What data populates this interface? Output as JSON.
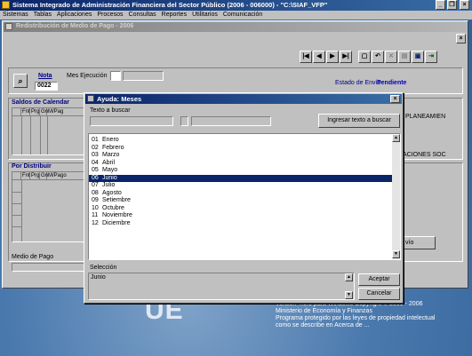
{
  "app": {
    "title": "Sistema Integrado de Administración Financiera del Sector Público (2006 - 006000) - \"C:\\SIAF_VFP\"",
    "menu": [
      "Sistemas",
      "Tablas",
      "Aplicaciones",
      "Procesos",
      "Consultas",
      "Reportes",
      "Utilitarios",
      "Comunicación"
    ]
  },
  "main_window": {
    "title": "Redistribución de Medio de Pago - 2006",
    "nota_label": "Nota",
    "nota_value": "0022",
    "mes_ejecucion_label": "Mes Ejecución",
    "estado_envio_label": "Estado de Envío",
    "estado_envio_value": "Pendiente",
    "saldos_label": "Saldos de Calendar",
    "saldos_columns": [
      "Fnt",
      "Prg",
      "Gn",
      "M/Pag"
    ],
    "por_distribuir_label": "Por Distribuir",
    "por_distribuir_columns": [
      "Fnt",
      "Prg",
      "Gn",
      "M/Pago"
    ],
    "medio_pago_label": "Medio de Pago",
    "right_text_1": "PLANEAMIEN",
    "right_text_2": "ACIONES SOC",
    "right_button": "vío"
  },
  "dialog": {
    "title": "Ayuda: Meses",
    "search_label": "Texto a buscar",
    "search_button": "Ingresar texto a buscar",
    "items": [
      {
        "code": "01",
        "name": "Enero"
      },
      {
        "code": "02",
        "name": "Febrero"
      },
      {
        "code": "03",
        "name": "Marzo"
      },
      {
        "code": "04",
        "name": "Abril"
      },
      {
        "code": "05",
        "name": "Mayo"
      },
      {
        "code": "06",
        "name": "Junio"
      },
      {
        "code": "07",
        "name": "Julio"
      },
      {
        "code": "08",
        "name": "Agosto"
      },
      {
        "code": "09",
        "name": "Setiembre"
      },
      {
        "code": "10",
        "name": "Octubre"
      },
      {
        "code": "11",
        "name": "Noviembre"
      },
      {
        "code": "12",
        "name": "Diciembre"
      }
    ],
    "selected_index": 5,
    "selection_label": "Selección",
    "selection_value": "Junio",
    "accept_button": "Aceptar",
    "cancel_button": "Cancelar"
  },
  "desktop": {
    "logo": "UE",
    "version_line": "Versión 4.9.3 para Windows Copyright © 2000 - 2006",
    "ministry_line": "Ministerio de Economía y Finanzas",
    "protected_line": "Programa protegido por las leyes de propiedad intelectual",
    "described_line": "como se describe en Acerca de ..."
  },
  "colors": {
    "selection": "#0a246a",
    "window_face": "#c0c0c0",
    "desktop": "#3d6ea5",
    "estado_text": "#0000c0"
  }
}
